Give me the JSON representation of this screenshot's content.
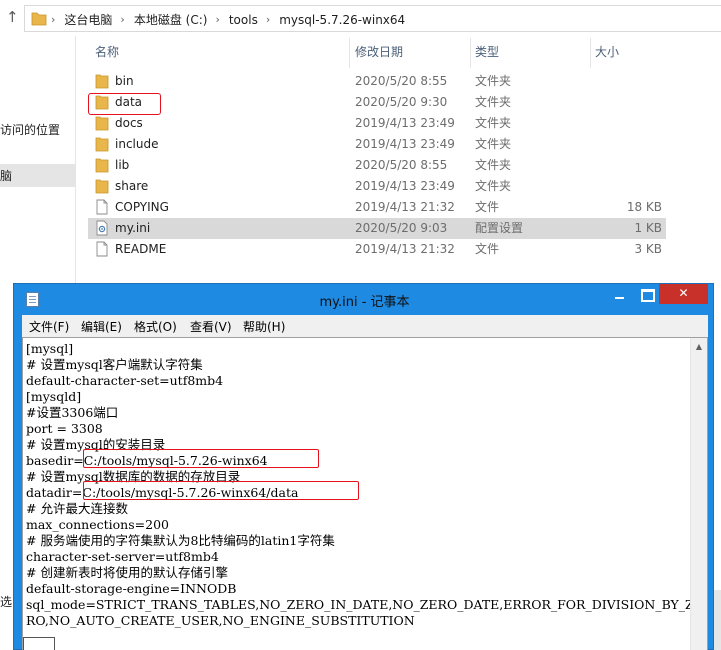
{
  "explorer": {
    "breadcrumbs": [
      "这台电脑",
      "本地磁盘 (C:)",
      "tools",
      "mysql-5.7.26-winx64"
    ],
    "nav": {
      "item_recent": "访问的位置",
      "item_selected": "脑",
      "item_bottom": "选"
    },
    "columns": {
      "name": "名称",
      "date": "修改日期",
      "type": "类型",
      "size": "大小"
    },
    "files": [
      {
        "name": "bin",
        "date": "2020/5/20 8:55",
        "type": "文件夹",
        "size": "",
        "icon": "folder-icon"
      },
      {
        "name": "data",
        "date": "2020/5/20 9:30",
        "type": "文件夹",
        "size": "",
        "icon": "folder-icon"
      },
      {
        "name": "docs",
        "date": "2019/4/13 23:49",
        "type": "文件夹",
        "size": "",
        "icon": "folder-icon"
      },
      {
        "name": "include",
        "date": "2019/4/13 23:49",
        "type": "文件夹",
        "size": "",
        "icon": "folder-icon"
      },
      {
        "name": "lib",
        "date": "2020/5/20 8:55",
        "type": "文件夹",
        "size": "",
        "icon": "folder-icon"
      },
      {
        "name": "share",
        "date": "2019/4/13 23:49",
        "type": "文件夹",
        "size": "",
        "icon": "folder-icon"
      },
      {
        "name": "COPYING",
        "date": "2019/4/13 21:32",
        "type": "文件",
        "size": "18 KB",
        "icon": "file-icon"
      },
      {
        "name": "my.ini",
        "date": "2020/5/20 9:03",
        "type": "配置设置",
        "size": "1 KB",
        "icon": "settings-file-icon"
      },
      {
        "name": "README",
        "date": "2019/4/13 21:32",
        "type": "文件",
        "size": "3 KB",
        "icon": "file-icon"
      }
    ]
  },
  "notepad": {
    "title": "my.ini - 记事本",
    "menu": [
      "文件(F)",
      "编辑(E)",
      "格式(O)",
      "查看(V)",
      "帮助(H)"
    ],
    "lines": [
      "[mysql]",
      "# 设置mysql客户端默认字符集",
      "default-character-set=utf8mb4",
      "[mysqld]",
      "#设置3306端口",
      "port = 3308",
      "# 设置mysql的安装目录",
      "basedir=C:/tools/mysql-5.7.26-winx64",
      "# 设置mysql数据库的数据的存放目录",
      "datadir=C:/tools/mysql-5.7.26-winx64/data",
      "# 允许最大连接数",
      "max_connections=200",
      "# 服务端使用的字符集默认为8比特编码的latin1字符集",
      "character-set-server=utf8mb4",
      "# 创建新表时将使用的默认存储引擎",
      "default-storage-engine=INNODB",
      "sql_mode=STRICT_TRANS_TABLES,NO_ZERO_IN_DATE,NO_ZERO_DATE,ERROR_FOR_DIVISION_BY_ZE",
      "RO,NO_AUTO_CREATE_USER,NO_ENGINE_SUBSTITUTION"
    ]
  },
  "colors": {
    "titlebar": "#1e8ae2",
    "close": "#c7312a",
    "highlight": "#e8111b",
    "folder": "#e8b64a"
  }
}
